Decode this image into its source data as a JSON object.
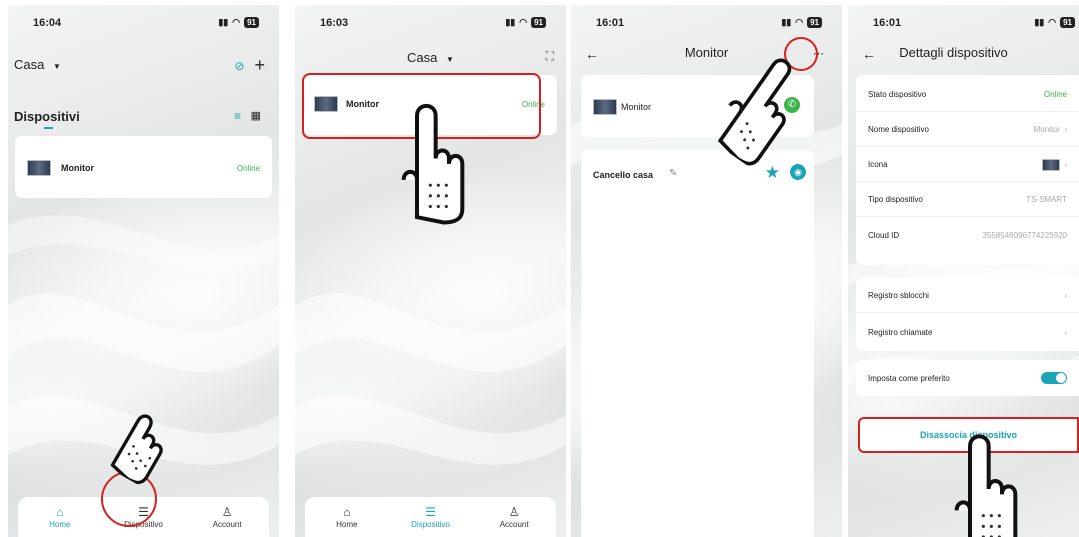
{
  "screen1": {
    "time": "16:04",
    "home_name": "Casa",
    "section_title": "Dispositivi",
    "device": {
      "name": "Monitor",
      "status": "Online"
    },
    "tabs": [
      {
        "label": "Home"
      },
      {
        "label": "Dispositivo"
      },
      {
        "label": "Account"
      }
    ]
  },
  "screen2": {
    "time": "16:03",
    "home_name": "Casa",
    "device": {
      "name": "Monitor",
      "status": "Online"
    },
    "tabs": [
      {
        "label": "Home"
      },
      {
        "label": "Dispositivo"
      },
      {
        "label": "Account"
      }
    ]
  },
  "screen3": {
    "time": "16:01",
    "title": "Monitor",
    "device_name": "Monitor",
    "camera_name": "Cancello casa"
  },
  "screen4": {
    "time": "16:01",
    "title": "Dettagli dispositivo",
    "rows": [
      {
        "label": "Stato dispositivo",
        "value": "Online"
      },
      {
        "label": "Nome dispositivo",
        "value": "Monitor"
      },
      {
        "label": "Icona",
        "value": ""
      },
      {
        "label": "Tipo dispositivo",
        "value": "TS-SMART"
      },
      {
        "label": "Cloud ID",
        "value": "3558546096774225920"
      }
    ],
    "logs": [
      {
        "label": "Registro sblocchi"
      },
      {
        "label": "Registro chiamate"
      }
    ],
    "favorite_label": "Imposta come preferito",
    "unbind_label": "Disassocia dispositivo"
  },
  "battery": "91",
  "colors": {
    "accent": "#1aa4b6",
    "online": "#3cb44b",
    "highlight": "#d81f1f"
  }
}
